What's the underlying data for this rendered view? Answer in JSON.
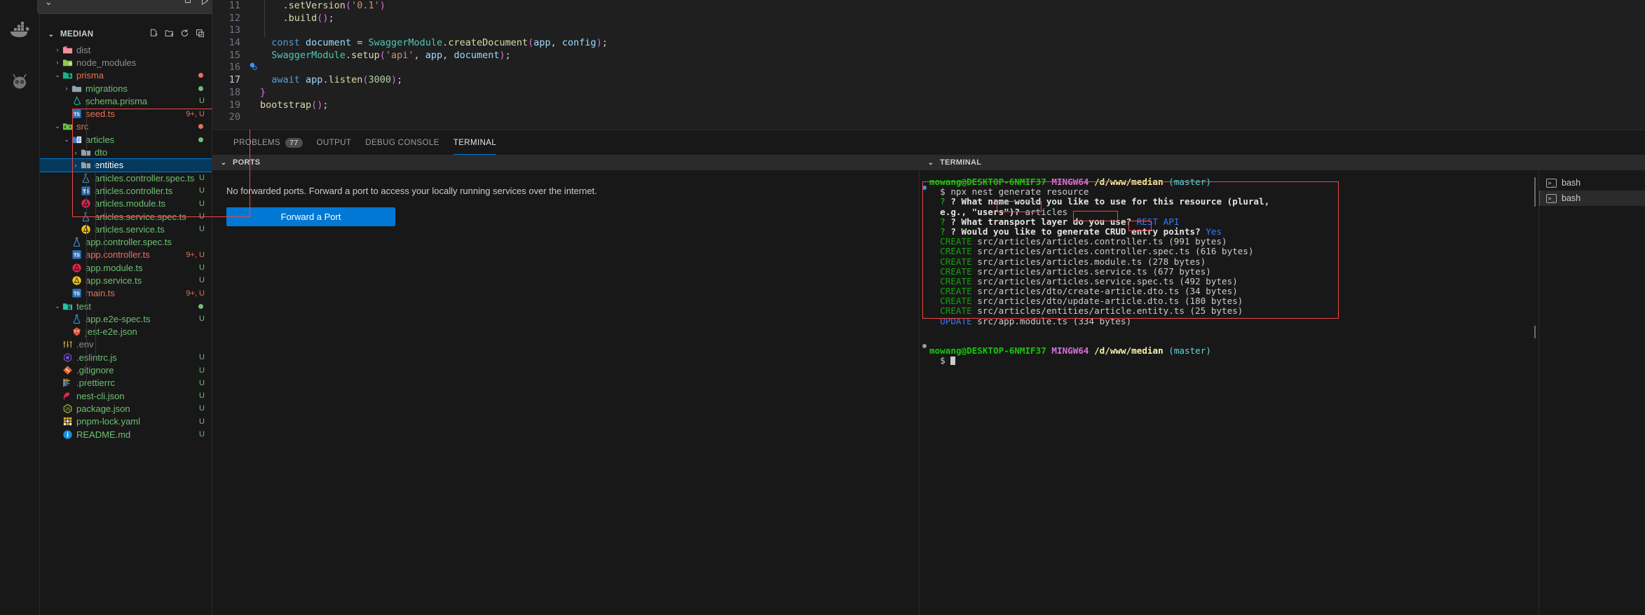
{
  "activity_bar": {
    "items": [
      {
        "name": "docker-icon",
        "label": "Docker"
      },
      {
        "name": "gitlens-icon",
        "label": "GitLens"
      }
    ]
  },
  "sidebar": {
    "search_caret": "⌄",
    "pill_icons": [
      "new-file-icon",
      "run-icon"
    ],
    "explorer_title": "MEDIAN",
    "header_actions": [
      "new-file-icon",
      "new-folder-icon",
      "refresh-icon",
      "collapse-icon"
    ],
    "tree": [
      {
        "label": "dist",
        "indent": 1,
        "arrow": "›",
        "icon": "folder-dist",
        "color": "c-gray",
        "badge": "",
        "dot": ""
      },
      {
        "label": "node_modules",
        "indent": 1,
        "arrow": "›",
        "icon": "folder-node",
        "color": "c-gray",
        "badge": "",
        "dot": ""
      },
      {
        "label": "prisma",
        "indent": 1,
        "arrow": "⌄",
        "icon": "folder-prisma",
        "color": "c-red",
        "badge": "",
        "dot": "#e8715a"
      },
      {
        "label": "migrations",
        "indent": 2,
        "arrow": "›",
        "icon": "folder-plain",
        "color": "c-green",
        "badge": "",
        "dot": "#6fbf73"
      },
      {
        "label": "schema.prisma",
        "indent": 2,
        "arrow": "",
        "icon": "prisma-file",
        "color": "c-green",
        "badge": "U",
        "dot": ""
      },
      {
        "label": "seed.ts",
        "indent": 2,
        "arrow": "",
        "icon": "ts-file",
        "color": "c-red",
        "badge": "9+, U",
        "dot": ""
      },
      {
        "label": "src",
        "indent": 1,
        "arrow": "⌄",
        "icon": "folder-src",
        "color": "c-red",
        "badge": "",
        "dot": "#e8715a"
      },
      {
        "label": "articles",
        "indent": 2,
        "arrow": "⌄",
        "icon": "folder-articles",
        "color": "c-green",
        "badge": "",
        "dot": "#6fbf73"
      },
      {
        "label": "dto",
        "indent": 3,
        "arrow": "›",
        "icon": "folder-plain",
        "color": "c-green",
        "badge": "",
        "dot": ""
      },
      {
        "label": "entities",
        "indent": 3,
        "arrow": "›",
        "icon": "folder-plain",
        "color": "c-green",
        "badge": "",
        "dot": "",
        "selected": true
      },
      {
        "label": "articles.controller.spec.ts",
        "indent": 3,
        "arrow": "",
        "icon": "test-file",
        "color": "c-green",
        "badge": "U",
        "dot": ""
      },
      {
        "label": "articles.controller.ts",
        "indent": 3,
        "arrow": "",
        "icon": "ts-file",
        "color": "c-green",
        "badge": "U",
        "dot": ""
      },
      {
        "label": "articles.module.ts",
        "indent": 3,
        "arrow": "",
        "icon": "nest-red",
        "color": "c-green",
        "badge": "U",
        "dot": ""
      },
      {
        "label": "articles.service.spec.ts",
        "indent": 3,
        "arrow": "",
        "icon": "test-file",
        "color": "c-green",
        "badge": "U",
        "dot": ""
      },
      {
        "label": "articles.service.ts",
        "indent": 3,
        "arrow": "",
        "icon": "nest-yellow",
        "color": "c-green",
        "badge": "U",
        "dot": ""
      },
      {
        "label": "app.controller.spec.ts",
        "indent": 2,
        "arrow": "",
        "icon": "test-file",
        "color": "c-green",
        "badge": "",
        "dot": ""
      },
      {
        "label": "app.controller.ts",
        "indent": 2,
        "arrow": "",
        "icon": "ts-file",
        "color": "c-red",
        "badge": "9+, U",
        "dot": ""
      },
      {
        "label": "app.module.ts",
        "indent": 2,
        "arrow": "",
        "icon": "nest-red",
        "color": "c-green",
        "badge": "U",
        "dot": ""
      },
      {
        "label": "app.service.ts",
        "indent": 2,
        "arrow": "",
        "icon": "nest-yellow",
        "color": "c-green",
        "badge": "U",
        "dot": ""
      },
      {
        "label": "main.ts",
        "indent": 2,
        "arrow": "",
        "icon": "ts-file",
        "color": "c-red",
        "badge": "9+, U",
        "dot": ""
      },
      {
        "label": "test",
        "indent": 1,
        "arrow": "⌄",
        "icon": "folder-test",
        "color": "c-green",
        "badge": "",
        "dot": "#6fbf73"
      },
      {
        "label": "app.e2e-spec.ts",
        "indent": 2,
        "arrow": "",
        "icon": "test-file",
        "color": "c-green",
        "badge": "U",
        "dot": ""
      },
      {
        "label": "jest-e2e.json",
        "indent": 2,
        "arrow": "",
        "icon": "jest-file",
        "color": "c-green",
        "badge": "",
        "dot": ""
      },
      {
        "label": ".env",
        "indent": 1,
        "arrow": "",
        "icon": "env-file",
        "color": "c-gray",
        "badge": "",
        "dot": ""
      },
      {
        "label": ".eslintrc.js",
        "indent": 1,
        "arrow": "",
        "icon": "eslint-file",
        "color": "c-green",
        "badge": "U",
        "dot": ""
      },
      {
        "label": ".gitignore",
        "indent": 1,
        "arrow": "",
        "icon": "git-file",
        "color": "c-green",
        "badge": "U",
        "dot": ""
      },
      {
        "label": ".prettierrc",
        "indent": 1,
        "arrow": "",
        "icon": "prettier-file",
        "color": "c-green",
        "badge": "U",
        "dot": ""
      },
      {
        "label": "nest-cli.json",
        "indent": 1,
        "arrow": "",
        "icon": "nest-cli-file",
        "color": "c-green",
        "badge": "U",
        "dot": ""
      },
      {
        "label": "package.json",
        "indent": 1,
        "arrow": "",
        "icon": "json-file",
        "color": "c-green",
        "badge": "U",
        "dot": ""
      },
      {
        "label": "pnpm-lock.yaml",
        "indent": 1,
        "arrow": "",
        "icon": "yaml-file",
        "color": "c-green",
        "badge": "U",
        "dot": ""
      },
      {
        "label": "README.md",
        "indent": 1,
        "arrow": "",
        "icon": "readme-file",
        "color": "c-green",
        "badge": "U",
        "dot": ""
      }
    ]
  },
  "editor": {
    "lines": [
      {
        "num": "11",
        "html": "    <span class='t-pun'>.</span><span class='t-fn'>setVersion</span><span class='t-paren'>(</span><span class='t-str'>'0.1'</span><span class='t-paren'>)</span>"
      },
      {
        "num": "12",
        "html": "    <span class='t-pun'>.</span><span class='t-fn'>build</span><span class='t-paren'>()</span><span class='t-pun'>;</span>"
      },
      {
        "num": "13",
        "html": ""
      },
      {
        "num": "14",
        "html": "  <span class='t-key'>const</span> <span class='t-var'>document</span> <span class='t-pun'>=</span> <span class='t-type'>SwaggerModule</span><span class='t-pun'>.</span><span class='t-fn'>createDocument</span><span class='t-paren'>(</span><span class='t-var'>app</span><span class='t-pun'>,</span> <span class='t-var'>config</span><span class='t-paren'>)</span><span class='t-pun'>;</span>"
      },
      {
        "num": "15",
        "html": "  <span class='t-type'>SwaggerModule</span><span class='t-pun'>.</span><span class='t-fn'>setup</span><span class='t-paren'>(</span><span class='t-str'>'api'</span><span class='t-pun'>,</span> <span class='t-var'>app</span><span class='t-pun'>,</span> <span class='t-var'>document</span><span class='t-paren'>)</span><span class='t-pun'>;</span>"
      },
      {
        "num": "16",
        "html": ""
      },
      {
        "num": "17",
        "html": "  <span class='t-key'>await</span> <span class='t-var'>app</span><span class='t-pun'>.</span><span class='t-fn'>listen</span><span class='t-paren'>(</span><span class='t-num'>3000</span><span class='t-paren'>)</span><span class='t-pun'>;</span>"
      },
      {
        "num": "18",
        "html": "<span class='t-paren'>}</span>"
      },
      {
        "num": "19",
        "html": "<span class='t-fn'>bootstrap</span><span class='t-paren'>()</span><span class='t-pun'>;</span>"
      },
      {
        "num": "20",
        "html": ""
      }
    ]
  },
  "panel": {
    "tabs": [
      {
        "label": "PROBLEMS",
        "badge": "77",
        "active": false
      },
      {
        "label": "OUTPUT",
        "badge": "",
        "active": false
      },
      {
        "label": "DEBUG CONSOLE",
        "badge": "",
        "active": false
      },
      {
        "label": "TERMINAL",
        "badge": "",
        "active": true
      }
    ],
    "ports": {
      "title": "PORTS",
      "empty_message": "No forwarded ports. Forward a port to access your locally running services over the internet.",
      "forward_button": "Forward a Port"
    },
    "terminal": {
      "title": "TERMINAL",
      "prompt_user": "mowang@DESKTOP-6NMIF37",
      "prompt_shell": "MINGW64",
      "prompt_path": "/d/www/median",
      "prompt_branch": "(master)",
      "command": "$ npx nest generate resource",
      "q1": "? What name would you like to use for this resource (plural,",
      "q1b": "e.g., \"users\")?",
      "a1": "articles",
      "q2": "? What transport layer do you use?",
      "a2": "REST API",
      "q3": "? Would you like to generate CRUD entry points?",
      "a3": "Yes",
      "output_lines": [
        {
          "verb": "CREATE",
          "path": "src/articles/articles.controller.ts",
          "size": "(991 bytes)"
        },
        {
          "verb": "CREATE",
          "path": "src/articles/articles.controller.spec.ts",
          "size": "(616 bytes)"
        },
        {
          "verb": "CREATE",
          "path": "src/articles/articles.module.ts",
          "size": "(278 bytes)"
        },
        {
          "verb": "CREATE",
          "path": "src/articles/articles.service.ts",
          "size": "(677 bytes)"
        },
        {
          "verb": "CREATE",
          "path": "src/articles/articles.service.spec.ts",
          "size": "(492 bytes)"
        },
        {
          "verb": "CREATE",
          "path": "src/articles/dto/create-article.dto.ts",
          "size": "(34 bytes)"
        },
        {
          "verb": "CREATE",
          "path": "src/articles/dto/update-article.dto.ts",
          "size": "(180 bytes)"
        },
        {
          "verb": "CREATE",
          "path": "src/articles/entities/article.entity.ts",
          "size": "(25 bytes)"
        },
        {
          "verb": "UPDATE",
          "path": "src/app.module.ts",
          "size": "(334 bytes)"
        }
      ],
      "final_prompt_symbol": "$",
      "tabs": [
        {
          "label": "bash",
          "active": false
        },
        {
          "label": "bash",
          "active": true
        }
      ]
    }
  },
  "colors": {
    "accent": "#0078d4",
    "annotation": "#f24646",
    "selection": "#04395e",
    "background": "#1f1f1f",
    "sidebar_bg": "#181818"
  }
}
